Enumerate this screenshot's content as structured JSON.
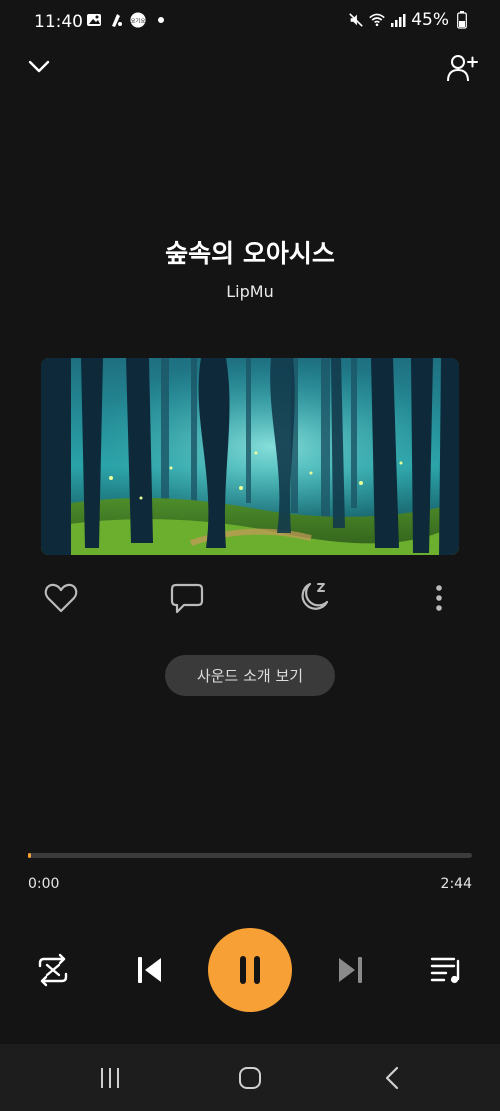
{
  "status": {
    "time": "11:40",
    "battery": "45%"
  },
  "header": {
    "collapse_icon": "chevron-down-icon",
    "add_user_icon": "add-user-icon"
  },
  "track": {
    "title": "숲속의 오아시스",
    "artist": "LipMu"
  },
  "actions": {
    "sound_intro_label": "사운드 소개 보기"
  },
  "progress": {
    "current": "0:00",
    "total": "2:44",
    "fraction": 0.005
  },
  "colors": {
    "background": "#141414",
    "accent": "#f7a035",
    "nav_background": "#1d1d1d"
  }
}
